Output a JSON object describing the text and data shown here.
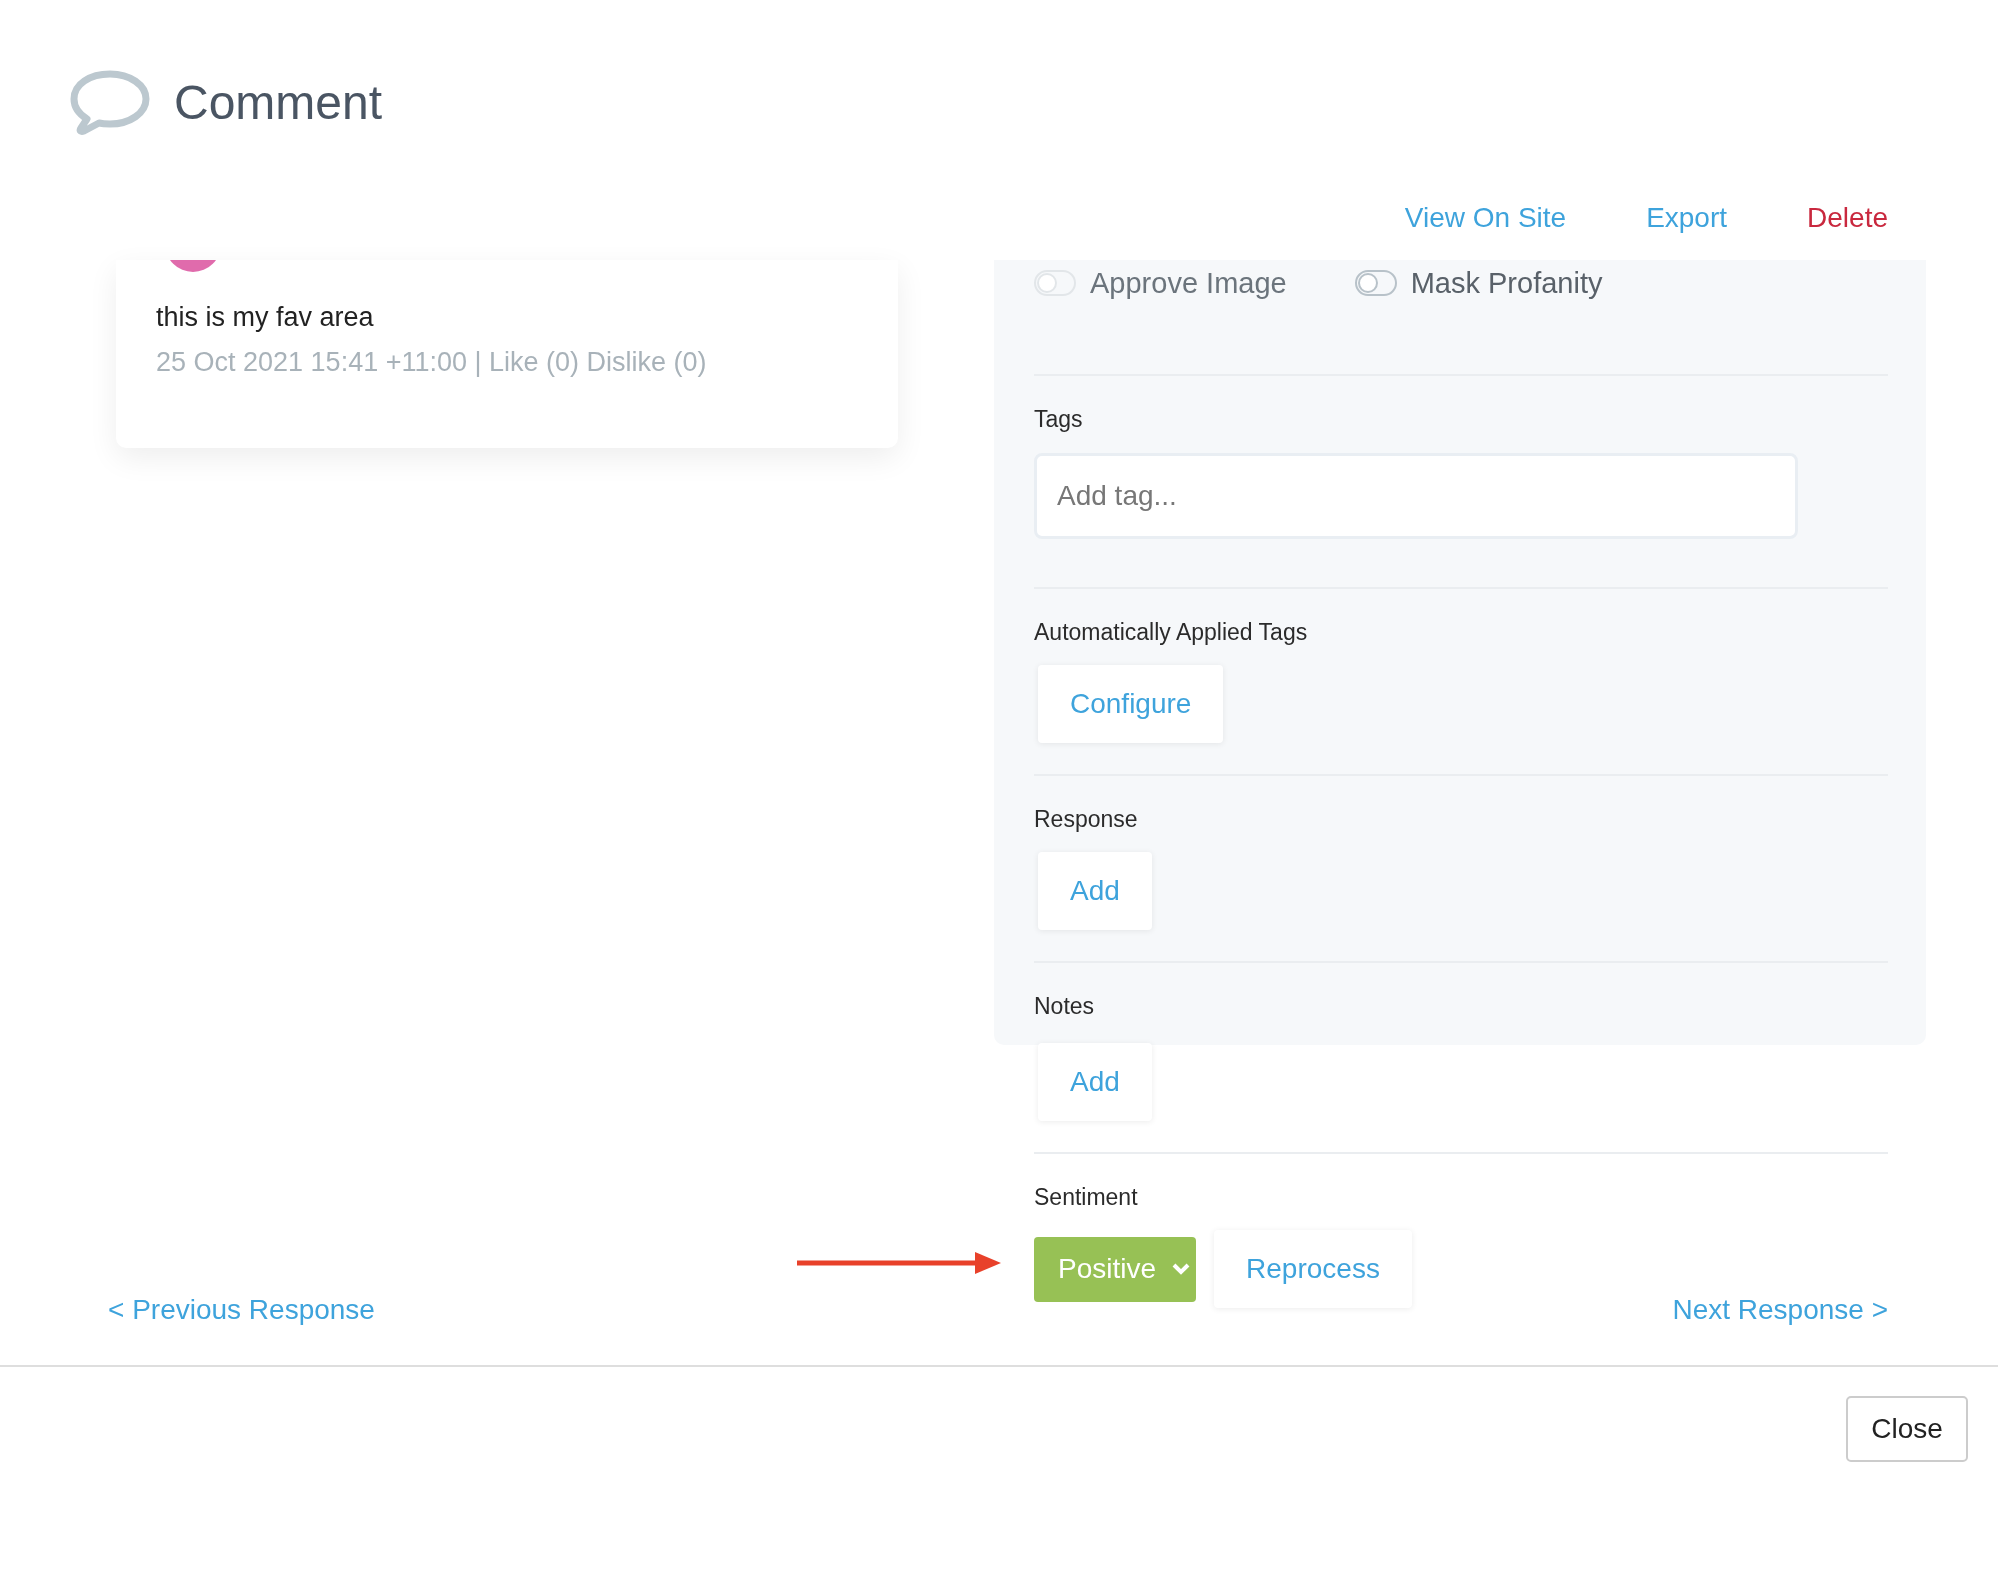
{
  "modal": {
    "title": "Comment"
  },
  "actions": [
    {
      "label": "View On Site",
      "kind": "link"
    },
    {
      "label": "Export",
      "kind": "link"
    },
    {
      "label": "Delete",
      "kind": "danger"
    }
  ],
  "comment": {
    "text": "this is my fav area",
    "meta": "25 Oct 2021 15:41 +11:00 | Like (0) Dislike (0)"
  },
  "toggles": [
    {
      "label": "Approve Image",
      "on": false,
      "disabled": true
    },
    {
      "label": "Mask Profanity",
      "on": false,
      "disabled": false
    }
  ],
  "tags": {
    "label": "Tags",
    "placeholder": "Add tag..."
  },
  "auto_tags": {
    "label": "Automatically Applied Tags",
    "button": "Configure"
  },
  "response": {
    "label": "Response",
    "button": "Add"
  },
  "notes": {
    "label": "Notes",
    "button": "Add"
  },
  "sentiment": {
    "label": "Sentiment",
    "value": "Positive",
    "color": "#97c155",
    "button": "Reprocess"
  },
  "navigation": {
    "previous": "< Previous Response",
    "next": "Next Response >"
  },
  "footer": {
    "close": "Close"
  }
}
